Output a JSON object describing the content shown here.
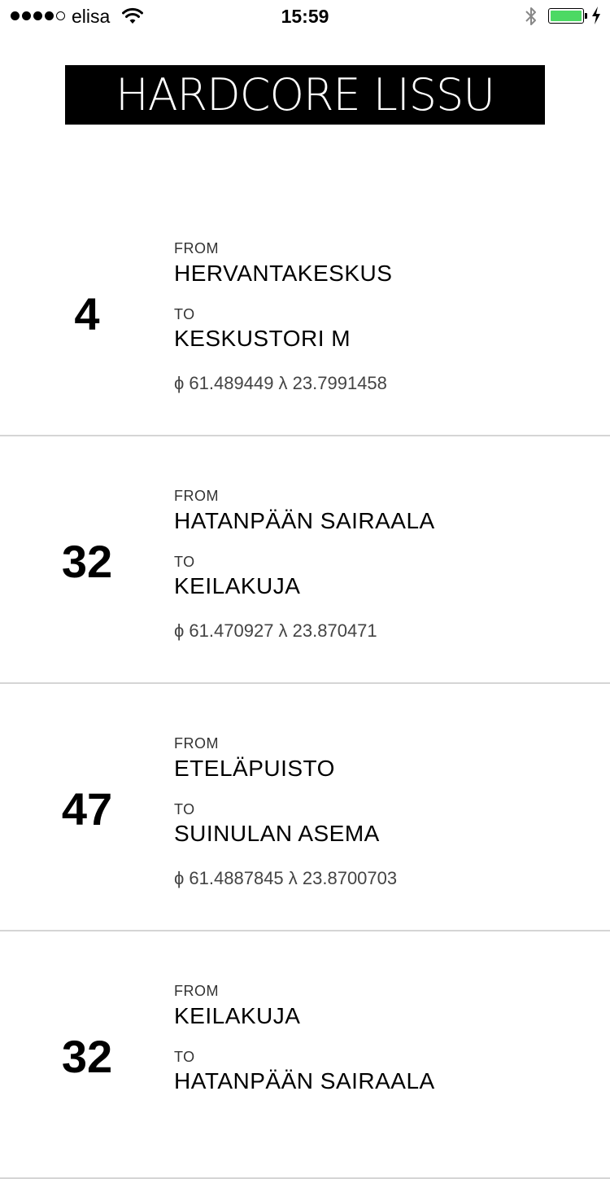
{
  "status_bar": {
    "signal_bars_filled": 4,
    "signal_bars_total": 5,
    "carrier": "elisa",
    "time": "15:59",
    "battery_level": 1.0,
    "battery_color": "#4cd964",
    "charging": true,
    "icons": [
      "wifi-icon",
      "bluetooth-icon",
      "battery-icon",
      "charging-bolt-icon"
    ]
  },
  "app": {
    "title": "HARDCORE LISSU"
  },
  "routes": [
    {
      "number": "4",
      "from_label": "FROM",
      "from": "HERVANTAKESKUS",
      "to_label": "TO",
      "to": "KESKUSTORI M",
      "coords": "ϕ 61.489449 λ 23.7991458"
    },
    {
      "number": "32",
      "from_label": "FROM",
      "from": "HATANPÄÄN SAIRAALA",
      "to_label": "TO",
      "to": "KEILAKUJA",
      "coords": "ϕ 61.470927 λ 23.870471"
    },
    {
      "number": "47",
      "from_label": "FROM",
      "from": "ETELÄPUISTO",
      "to_label": "TO",
      "to": "SUINULAN ASEMA",
      "coords": "ϕ 61.4887845 λ 23.8700703"
    },
    {
      "number": "32",
      "from_label": "FROM",
      "from": "KEILAKUJA",
      "to_label": "TO",
      "to": "HATANPÄÄN SAIRAALA",
      "coords": ""
    }
  ]
}
